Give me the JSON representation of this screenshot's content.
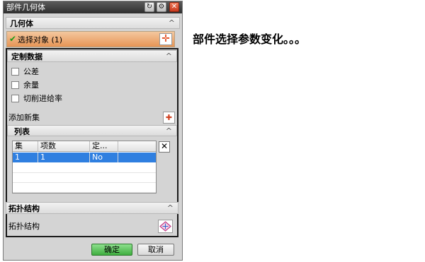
{
  "window": {
    "title": "部件几何体"
  },
  "sections": {
    "geometry": {
      "label": "几何体"
    },
    "select_object": {
      "label": "选择对象 (1)"
    },
    "custom_data": {
      "label": "定制数据"
    },
    "checkboxes": [
      {
        "label": "公差",
        "checked": false
      },
      {
        "label": "余量",
        "checked": false
      },
      {
        "label": "切削进给率",
        "checked": false
      }
    ],
    "add_set": {
      "label": "添加新集"
    },
    "list": {
      "label": "列表",
      "columns": [
        "集",
        "项数",
        "定..."
      ],
      "rows": [
        {
          "set": "1",
          "count": "1",
          "custom": "No"
        }
      ]
    },
    "topology": {
      "label": "拓扑结构",
      "row_label": "拓扑结构"
    }
  },
  "buttons": {
    "ok": "确定",
    "cancel": "取消"
  },
  "note": "部件选择参数变化。。。",
  "colors": {
    "selected_row": "#2f7fe0",
    "ok_button": "#3fae3f",
    "select_row": "#e79556"
  }
}
